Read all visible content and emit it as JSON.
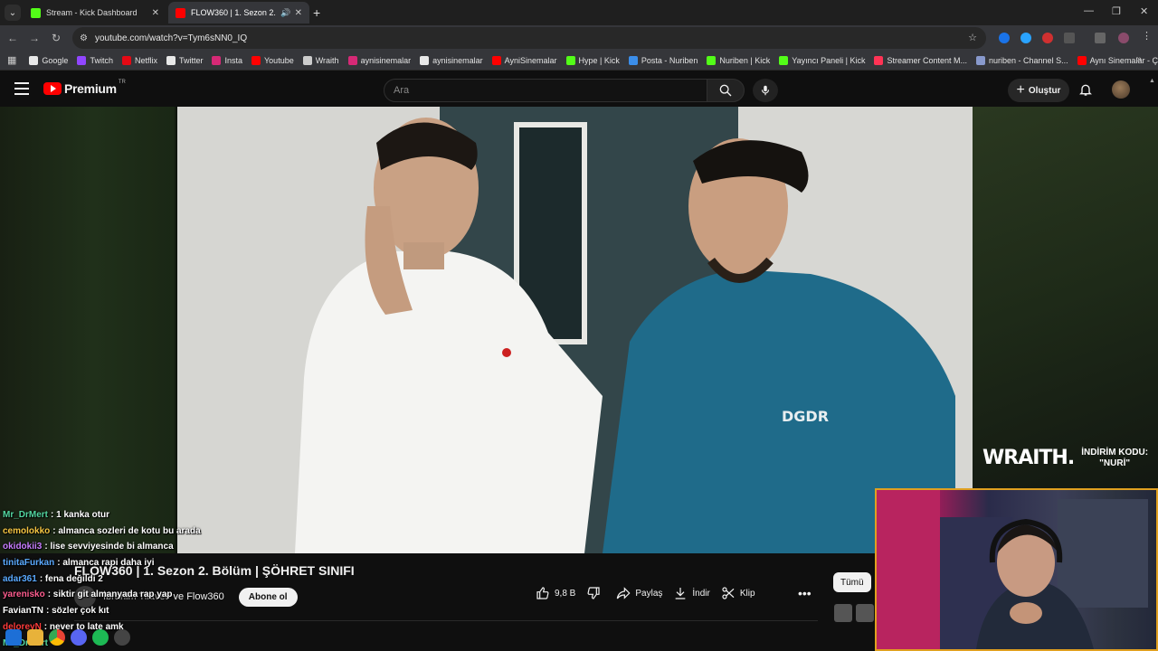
{
  "browser": {
    "tabs": [
      {
        "title": "Stream - Kick Dashboard",
        "favicon_color": "#53fc18",
        "active": false
      },
      {
        "title": "FLOW360 | 1. Sezon 2. Bölüm",
        "favicon_color": "#ff0000",
        "active": true
      }
    ],
    "url": "youtube.com/watch?v=Tym6sNN0_IQ",
    "bookmarks": [
      {
        "label": "Google",
        "color": "#e8e8e8"
      },
      {
        "label": "Twitch",
        "color": "#9146ff"
      },
      {
        "label": "Netflix",
        "color": "#e50914"
      },
      {
        "label": "Twitter",
        "color": "#e8e8e8"
      },
      {
        "label": "Insta",
        "color": "#d62976"
      },
      {
        "label": "Youtube",
        "color": "#ff0000"
      },
      {
        "label": "Wraith",
        "color": "#cccccc"
      },
      {
        "label": "aynisinemalar",
        "color": "#d62976"
      },
      {
        "label": "aynisinemalar",
        "color": "#e8e8e8"
      },
      {
        "label": "AyniSinemalar",
        "color": "#ff0000"
      },
      {
        "label": "Hype | Kick",
        "color": "#53fc18"
      },
      {
        "label": "Posta - Nuriben",
        "color": "#3b8eea"
      },
      {
        "label": "Nuriben | Kick",
        "color": "#53fc18"
      },
      {
        "label": "Yayıncı Paneli | Kick",
        "color": "#53fc18"
      },
      {
        "label": "Streamer Content M...",
        "color": "#ff3355"
      },
      {
        "label": "nuriben - Channel S...",
        "color": "#8899cc"
      },
      {
        "label": "Aynı Sinemalar - Ça...",
        "color": "#ff0000"
      }
    ]
  },
  "youtube": {
    "logo_text": "Premium",
    "logo_region": "TR",
    "search_placeholder": "Ara",
    "create_label": "Oluştur",
    "video_title": "FLOW360 | 1. Sezon 2. Bölüm | ŞÖHRET SINIFI",
    "channel_name": "ve Flow360",
    "channel_prefix": "İbrahim Tilavet",
    "subscribe_label": "Abone ol",
    "like_count": "9,8 B",
    "share_label": "Paylaş",
    "download_label": "İndir",
    "clip_label": "Klip",
    "filter_chip": "Tümü"
  },
  "overlay": {
    "wraith_brand": "WRAITH.",
    "wraith_code_line1": "İNDİRİM KODU:",
    "wraith_code_line2": "\"NURİ\""
  },
  "chat": [
    {
      "user": "Mr_DrMert",
      "color": "#53d6a0",
      "message": ": 1 kanka otur"
    },
    {
      "user": "cemolokko",
      "color": "#f5c542",
      "message": ": almanca sozleri de kotu bu arada"
    },
    {
      "user": "okidokii3",
      "color": "#c77dff",
      "message": ": lise sevviyesinde bi almanca"
    },
    {
      "user": "tinitaFurkan",
      "color": "#5aa9ff",
      "message": ": almanca rapi daha iyi"
    },
    {
      "user": "adar361",
      "color": "#5aa9ff",
      "message": ": fena değildi 2"
    },
    {
      "user": "yarenisko",
      "color": "#ff5d8f",
      "message": ": siktir git almanyada rap yap"
    },
    {
      "user": "FavianTN",
      "color": "#ffffff",
      "message": ": sözler çok kıt"
    },
    {
      "user": "deloreyN",
      "color": "#ff3b3b",
      "message": ": never to late amk"
    },
    {
      "user": "Mr_DrMert",
      "color": "#53d6a0",
      "message": ""
    }
  ]
}
